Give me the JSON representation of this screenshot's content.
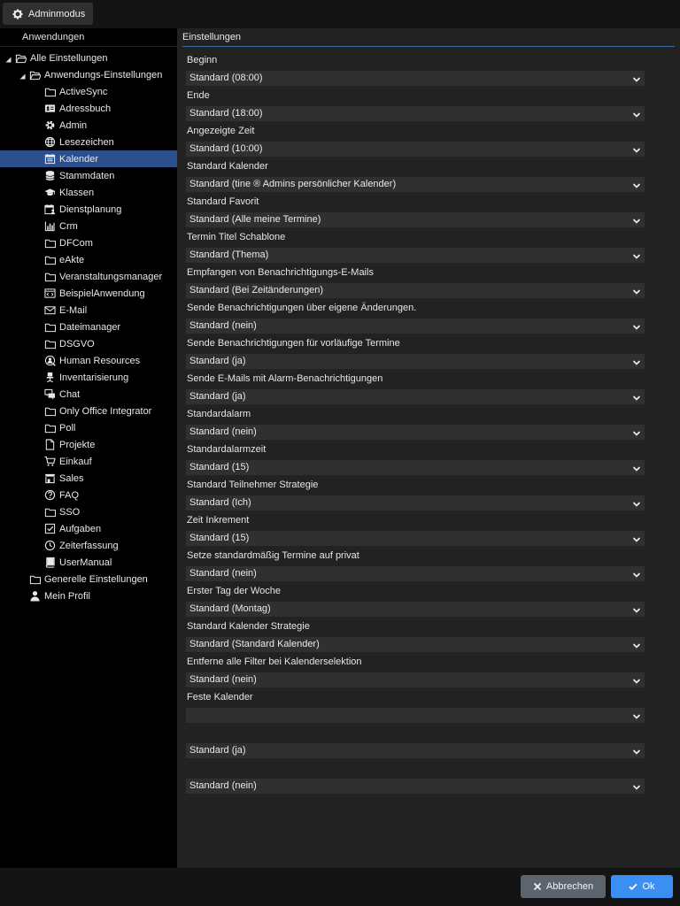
{
  "topbar": {
    "admin_label": "Adminmodus"
  },
  "sidebar": {
    "header": "Anwendungen",
    "items": [
      {
        "label": "Alle Einstellungen",
        "level": 0,
        "icon": "folder-open-icon",
        "expander": "expanded",
        "selected": false
      },
      {
        "label": "Anwendungs-Einstellungen",
        "level": 1,
        "icon": "folder-open-icon",
        "expander": "expanded",
        "selected": false
      },
      {
        "label": "ActiveSync",
        "level": 2,
        "icon": "folder-icon",
        "selected": false
      },
      {
        "label": "Adressbuch",
        "level": 2,
        "icon": "contact-card-icon",
        "selected": false
      },
      {
        "label": "Admin",
        "level": 2,
        "icon": "gear-icon",
        "selected": false
      },
      {
        "label": "Lesezeichen",
        "level": 2,
        "icon": "globe-icon",
        "selected": false
      },
      {
        "label": "Kalender",
        "level": 2,
        "icon": "calendar-icon",
        "selected": true
      },
      {
        "label": "Stammdaten",
        "level": 2,
        "icon": "database-icon",
        "selected": false
      },
      {
        "label": "Klassen",
        "level": 2,
        "icon": "graduation-cap-icon",
        "selected": false
      },
      {
        "label": "Dienstplanung",
        "level": 2,
        "icon": "calendar-user-icon",
        "selected": false
      },
      {
        "label": "Crm",
        "level": 2,
        "icon": "bar-chart-icon",
        "selected": false
      },
      {
        "label": "DFCom",
        "level": 2,
        "icon": "folder-icon",
        "selected": false
      },
      {
        "label": "eAkte",
        "level": 2,
        "icon": "folder-icon",
        "selected": false
      },
      {
        "label": "Veranstaltungsmanager",
        "level": 2,
        "icon": "folder-icon",
        "selected": false
      },
      {
        "label": "BeispielAnwendung",
        "level": 2,
        "icon": "code-window-icon",
        "selected": false
      },
      {
        "label": "E-Mail",
        "level": 2,
        "icon": "envelope-icon",
        "selected": false
      },
      {
        "label": "Dateimanager",
        "level": 2,
        "icon": "folder-icon",
        "selected": false
      },
      {
        "label": "DSGVO",
        "level": 2,
        "icon": "folder-icon",
        "selected": false
      },
      {
        "label": "Human Resources",
        "level": 2,
        "icon": "user-search-icon",
        "selected": false
      },
      {
        "label": "Inventarisierung",
        "level": 2,
        "icon": "office-chair-icon",
        "selected": false
      },
      {
        "label": "Chat",
        "level": 2,
        "icon": "chat-icon",
        "selected": false
      },
      {
        "label": "Only Office Integrator",
        "level": 2,
        "icon": "folder-icon",
        "selected": false
      },
      {
        "label": "Poll",
        "level": 2,
        "icon": "folder-icon",
        "selected": false
      },
      {
        "label": "Projekte",
        "level": 2,
        "icon": "document-icon",
        "selected": false
      },
      {
        "label": "Einkauf",
        "level": 2,
        "icon": "shopping-cart-icon",
        "selected": false
      },
      {
        "label": "Sales",
        "level": 2,
        "icon": "store-icon",
        "selected": false
      },
      {
        "label": "FAQ",
        "level": 2,
        "icon": "question-icon",
        "selected": false
      },
      {
        "label": "SSO",
        "level": 2,
        "icon": "folder-icon",
        "selected": false
      },
      {
        "label": "Aufgaben",
        "level": 2,
        "icon": "checkbox-icon",
        "selected": false
      },
      {
        "label": "Zeiterfassung",
        "level": 2,
        "icon": "clock-icon",
        "selected": false
      },
      {
        "label": "UserManual",
        "level": 2,
        "icon": "book-icon",
        "selected": false
      },
      {
        "label": "Generelle Einstellungen",
        "level": 1,
        "icon": "folder-icon",
        "selected": false
      },
      {
        "label": "Mein Profil",
        "level": 1,
        "icon": "user-icon",
        "selected": false
      }
    ]
  },
  "main": {
    "header": "Einstellungen",
    "fields": [
      {
        "label": "Beginn",
        "value": "Standard (08:00)"
      },
      {
        "label": "Ende",
        "value": "Standard (18:00)"
      },
      {
        "label": "Angezeigte Zeit",
        "value": "Standard (10:00)"
      },
      {
        "label": "Standard Kalender",
        "value": "Standard (tine ® Admins persönlicher Kalender)"
      },
      {
        "label": "Standard Favorit",
        "value": "Standard (Alle meine Termine)"
      },
      {
        "label": "Termin Titel Schablone",
        "value": "Standard (Thema)"
      },
      {
        "label": "Empfangen von Benachrichtigungs-E-Mails",
        "value": "Standard (Bei Zeitänderungen)"
      },
      {
        "label": "Sende Benachrichtigungen über eigene Änderungen.",
        "value": "Standard (nein)"
      },
      {
        "label": "Sende Benachrichtigungen für vorläufige Termine",
        "value": "Standard (ja)"
      },
      {
        "label": "Sende E-Mails mit Alarm-Benachrichtigungen",
        "value": "Standard (ja)"
      },
      {
        "label": "Standardalarm",
        "value": "Standard (nein)"
      },
      {
        "label": "Standardalarmzeit",
        "value": "Standard (15)"
      },
      {
        "label": "Standard Teilnehmer Strategie",
        "value": "Standard (Ich)"
      },
      {
        "label": "Zeit Inkrement",
        "value": "Standard (15)"
      },
      {
        "label": "Setze standardmäßig Termine auf privat",
        "value": "Standard (nein)"
      },
      {
        "label": "Erster Tag der Woche",
        "value": "Standard (Montag)"
      },
      {
        "label": "Standard Kalender Strategie",
        "value": "Standard (Standard Kalender)"
      },
      {
        "label": "Entferne alle Filter bei Kalenderselektion",
        "value": "Standard (nein)"
      },
      {
        "label": "Feste Kalender",
        "value": ""
      },
      {
        "label": "",
        "value": "Standard (ja)"
      },
      {
        "label": "",
        "value": "Standard (nein)"
      }
    ]
  },
  "footer": {
    "cancel_label": "Abbrechen",
    "ok_label": "Ok"
  },
  "colors": {
    "accent": "#3b8ff0",
    "selection": "#2b4f8c",
    "cancel": "#5e646e"
  }
}
